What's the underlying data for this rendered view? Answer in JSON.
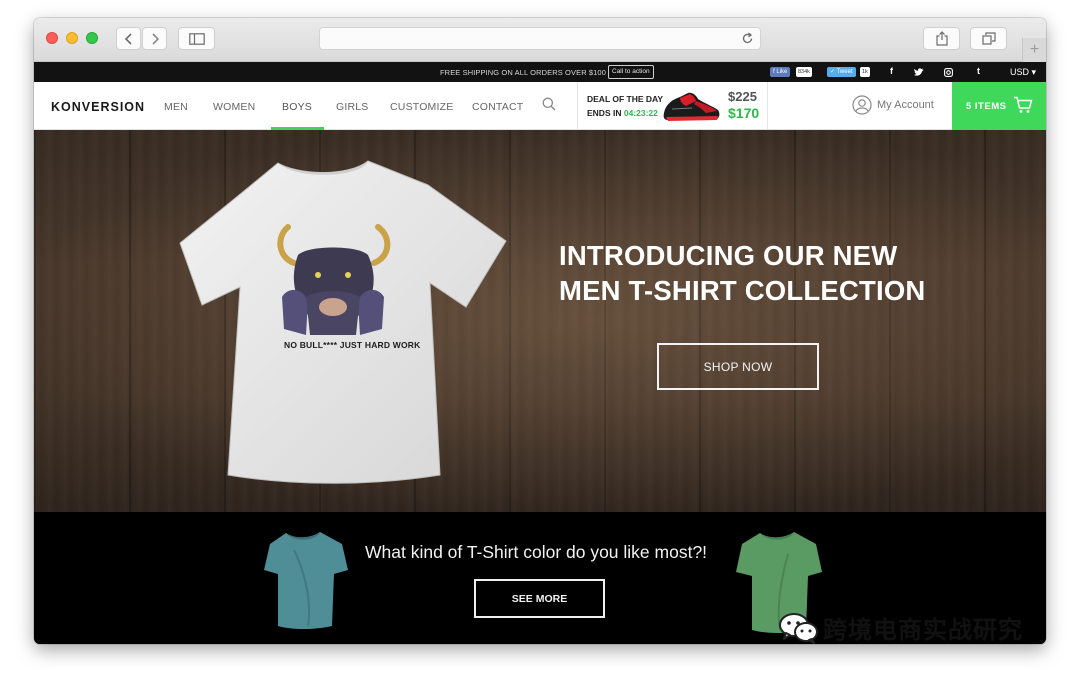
{
  "browser": {
    "url": "",
    "icons": [
      "back-icon",
      "forward-icon",
      "sidebar-icon",
      "reload-icon",
      "share-icon",
      "tabs-icon",
      "plus-icon"
    ]
  },
  "topbar": {
    "shipping_text": "FREE SHIPPING ON ALL ORDERS OVER $100",
    "cta_label": "Call to action",
    "like_label": "Like",
    "like_count": "834k",
    "tweet_label": "Tweet",
    "tweet_count": "1k",
    "currency": "USD ▾"
  },
  "nav": {
    "logo": "KONVERSION",
    "items": [
      "MEN",
      "WOMEN",
      "BOYS",
      "GIRLS",
      "CUSTOMIZE",
      "CONTACT"
    ],
    "active_item": "BOYS",
    "deal": {
      "title": "DEAL OF THE DAY",
      "ends_label": "ENDS IN",
      "timer": "04:23:22",
      "old_price": "$225",
      "new_price": "$170"
    },
    "account_label": "My Account",
    "cart_label": "5 ITEMS"
  },
  "hero": {
    "shirt_text": "NO BULL**** JUST HARD WORK",
    "headline_line1": "INTRODUCING OUR NEW",
    "headline_line2": "MEN T-SHIRT COLLECTION",
    "button_label": "SHOP NOW"
  },
  "promo": {
    "question": "What kind of T-Shirt color do you like most?!",
    "button_label": "SEE MORE"
  },
  "watermark": {
    "text": "跨境电商实战研究"
  },
  "colors": {
    "accent_green": "#3fd85a",
    "timer_green": "#2fb84a",
    "topbar": "#121212"
  }
}
